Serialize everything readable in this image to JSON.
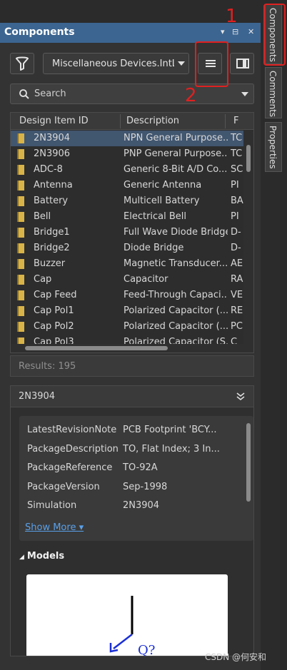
{
  "panel": {
    "title": "Components",
    "title_controls": [
      "▾",
      "⊟",
      "✕"
    ]
  },
  "toolbar": {
    "library_selected": "Miscellaneous Devices.IntLib"
  },
  "search": {
    "placeholder": "Search"
  },
  "grid": {
    "columns": [
      "Design Item ID",
      "Description",
      "F"
    ],
    "rows": [
      {
        "id": "2N3904",
        "desc": "NPN General Purpose...",
        "fp": "TC"
      },
      {
        "id": "2N3906",
        "desc": "PNP General Purpose...",
        "fp": "TC"
      },
      {
        "id": "ADC-8",
        "desc": "Generic 8-Bit A/D Co...",
        "fp": "SC"
      },
      {
        "id": "Antenna",
        "desc": "Generic Antenna",
        "fp": "PI"
      },
      {
        "id": "Battery",
        "desc": "Multicell Battery",
        "fp": "BA"
      },
      {
        "id": "Bell",
        "desc": "Electrical Bell",
        "fp": "PI"
      },
      {
        "id": "Bridge1",
        "desc": "Full Wave Diode Bridge",
        "fp": "D-"
      },
      {
        "id": "Bridge2",
        "desc": "Diode Bridge",
        "fp": "D-"
      },
      {
        "id": "Buzzer",
        "desc": "Magnetic Transducer...",
        "fp": "AE"
      },
      {
        "id": "Cap",
        "desc": "Capacitor",
        "fp": "RA"
      },
      {
        "id": "Cap Feed",
        "desc": "Feed-Through Capaci...",
        "fp": "VE"
      },
      {
        "id": "Cap Pol1",
        "desc": "Polarized Capacitor (...",
        "fp": "RE"
      },
      {
        "id": "Cap Pol2",
        "desc": "Polarized Capacitor (...",
        "fp": "PC"
      },
      {
        "id": "Cap Pol3",
        "desc": "Polarized Capacitor (S...",
        "fp": "C"
      }
    ]
  },
  "results": "Results: 195",
  "details": {
    "name": "2N3904",
    "properties": [
      {
        "key": "LatestRevisionNote",
        "value": "PCB Footprint 'BCY..."
      },
      {
        "key": "PackageDescription",
        "value": "TO, Flat Index; 3 In..."
      },
      {
        "key": "PackageReference",
        "value": "TO-92A"
      },
      {
        "key": "PackageVersion",
        "value": "Sep-1998"
      },
      {
        "key": "Simulation",
        "value": "2N3904"
      }
    ],
    "show_more": "Show More ▾",
    "models_label": "Models",
    "preview_designator": "Q?"
  },
  "side_tabs": [
    "Components",
    "Comments",
    "Properties"
  ],
  "annotations": [
    "1",
    "2"
  ],
  "watermark": "CSDN @何安和",
  "colors": {
    "titlebar": "#3c6591",
    "selected_row": "#41566f",
    "link": "#5aa0e8",
    "annotation": "#e02020"
  }
}
